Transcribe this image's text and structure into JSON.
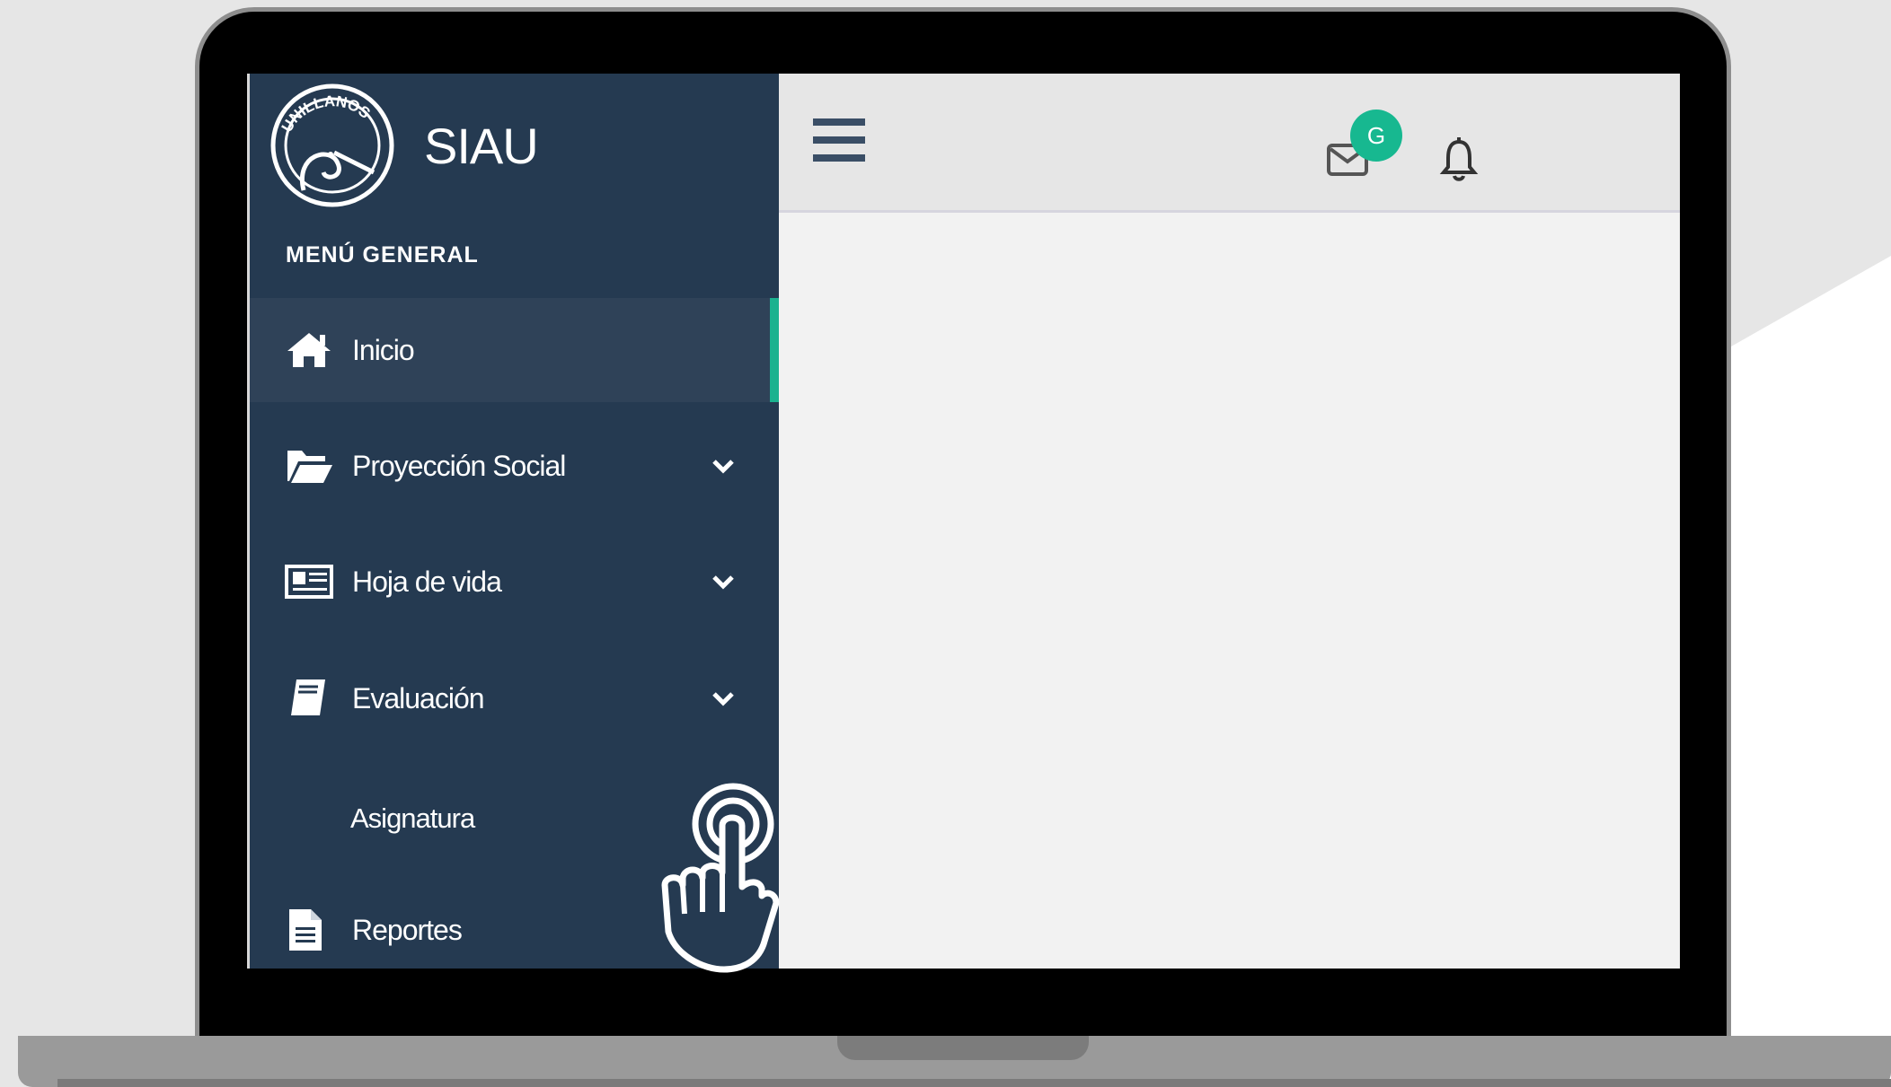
{
  "app": {
    "name": "SIAU",
    "logo_text": "UNILLANOS"
  },
  "sidebar": {
    "section_title": "MENÚ GENERAL",
    "items": [
      {
        "label": "Inicio",
        "icon": "home-icon",
        "active": true,
        "has_submenu": false
      },
      {
        "label": "Proyección Social",
        "icon": "folder-open-icon",
        "has_submenu": true
      },
      {
        "label": "Hoja de vida",
        "icon": "id-card-icon",
        "has_submenu": true
      },
      {
        "label": "Evaluación",
        "icon": "book-icon",
        "has_submenu": true
      },
      {
        "label": "Reportes",
        "icon": "file-icon",
        "has_submenu": true
      }
    ],
    "subitems": [
      {
        "label": "Asignatura",
        "parent": "Evaluación"
      }
    ]
  },
  "topbar": {
    "menu_icon": "hamburger-icon",
    "mail": {
      "icon": "mail-icon",
      "badge": "G"
    },
    "notifications": {
      "icon": "bell-icon"
    }
  },
  "overlay": {
    "icon": "hand-tap-icon"
  },
  "colors": {
    "sidebar_bg": "#253a51",
    "active_item_bg": "#2f4258",
    "accent": "#1bb28f",
    "badge": "#17b890",
    "topbar_bg": "#e6e6e6",
    "content_bg": "#f2f2f2"
  }
}
